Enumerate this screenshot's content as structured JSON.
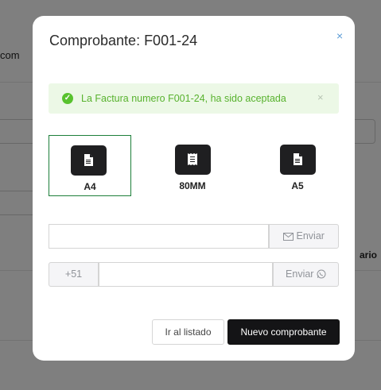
{
  "background": {
    "partial_text_left": "com",
    "partial_text_right": "ario"
  },
  "modal": {
    "title": "Comprobante: F001-24",
    "close_glyph": "×",
    "alert": {
      "message": "La Factura numero F001-24, ha sido aceptada",
      "icon": "check-circle-icon",
      "close_glyph": "×",
      "color": "#58b22e"
    },
    "formats": [
      {
        "label": "A4",
        "icon": "document-icon",
        "selected": true
      },
      {
        "label": "80MM",
        "icon": "receipt-icon",
        "selected": false
      },
      {
        "label": "A5",
        "icon": "document-icon",
        "selected": false
      }
    ],
    "email": {
      "value": "",
      "placeholder": "",
      "send_label": "Enviar",
      "icon": "envelope-icon"
    },
    "whatsapp": {
      "prefix": "+51",
      "value": "",
      "placeholder": "",
      "send_label": "Enviar",
      "icon": "whatsapp-icon"
    },
    "buttons": {
      "list": "Ir al listado",
      "new": "Nuevo comprobante"
    }
  }
}
